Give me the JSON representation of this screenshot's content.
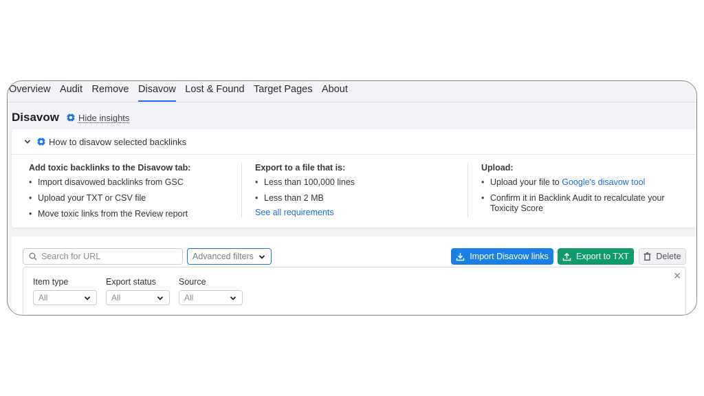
{
  "tabs": [
    "Overview",
    "Audit",
    "Remove",
    "Disavow",
    "Lost & Found",
    "Target Pages",
    "About"
  ],
  "active_tab": "Disavow",
  "page_title": "Disavow",
  "hide_insights_label": "Hide insights",
  "insights": {
    "header_label": "How to disavow selected backlinks",
    "columns": [
      {
        "heading": "Add toxic backlinks to the Disavow tab:",
        "items": [
          "Import disavowed backlinks from GSC",
          "Upload your TXT or CSV file",
          "Move toxic links from the Review report"
        ]
      },
      {
        "heading": "Export to a file that is:",
        "items": [
          "Less than 100,000 lines",
          "Less than 2 MB"
        ],
        "link": "See all requirements"
      },
      {
        "heading": "Upload:",
        "item1_prefix": "Upload your file to ",
        "item1_link": "Google's disavow tool",
        "item2": "Confirm it in Backlink Audit to recalculate your Toxicity Score"
      }
    ]
  },
  "toolbar": {
    "search_placeholder": "Search for URL",
    "advanced_filters_label": "Advanced filters",
    "import_label": "Import Disavow links",
    "export_label": "Export to TXT",
    "delete_label": "Delete"
  },
  "filters": [
    {
      "label": "Item type",
      "value": "All"
    },
    {
      "label": "Export status",
      "value": "All"
    },
    {
      "label": "Source",
      "value": "All"
    }
  ],
  "colors": {
    "accent": "#1a73e8",
    "import": "#1b80e6",
    "export": "#0f9b6a"
  },
  "icons": [
    "gear-icon",
    "chevron-down-icon",
    "search-icon",
    "download-icon",
    "upload-icon",
    "trash-icon",
    "close-icon"
  ]
}
